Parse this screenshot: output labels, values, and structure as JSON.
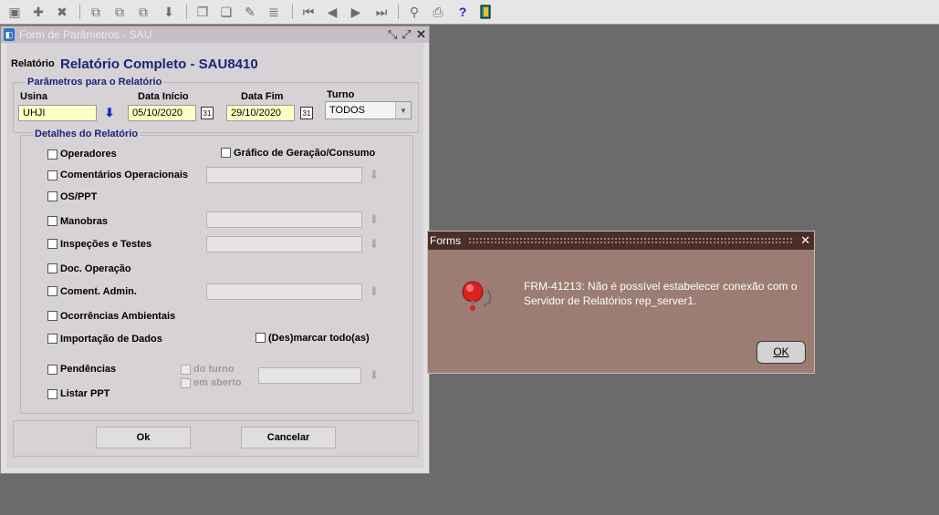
{
  "toolbar": {
    "icons": [
      "save-icon",
      "insert-record-icon",
      "delete-record-icon",
      "enter-query-icon",
      "execute-query-icon",
      "cancel-query-icon",
      "next-block-icon",
      "copy-icon",
      "paste-icon",
      "edit-icon",
      "display-list-icon",
      "first-record-icon",
      "previous-record-icon",
      "next-record-icon",
      "last-record-icon",
      "lock-icon",
      "print-icon",
      "help-icon",
      "exit-icon"
    ],
    "help_glyph": "?"
  },
  "form": {
    "window_title": "Form de Parâmetros - SAU",
    "report_label": "Relatório",
    "report_title": "Relatório Completo - SAU8410",
    "params_legend": "Parâmetros para o Relatório",
    "usina_label": "Usina",
    "usina_value": "UHJI",
    "data_inicio_label": "Data Início",
    "data_inicio_value": "05/10/2020",
    "data_fim_label": "Data Fim",
    "data_fim_value": "29/10/2020",
    "turno_label": "Turno",
    "turno_value": "TODOS",
    "calendar_glyph": "31",
    "details_legend": "Detalhes do Relatório",
    "checkboxes": {
      "operadores": "Operadores",
      "grafico": "Gráfico de Geração/Consumo",
      "comentarios": "Comentários Operacionais",
      "osppt": "OS/PPT",
      "manobras": "Manobras",
      "inspecoes": "Inspeções e Testes",
      "doc_operacao": "Doc. Operação",
      "coment_admin": "Coment. Admin.",
      "ocorrencias": "Ocorrências Ambientais",
      "importacao": "Importação de Dados",
      "desmarcar": "(Des)marcar todo(as)",
      "pendencias": "Pendências",
      "do_turno": "do turno",
      "em_aberto": "em aberto",
      "listar_ppt": "Listar PPT"
    },
    "ok_label": "Ok",
    "cancel_label": "Cancelar"
  },
  "dialog": {
    "title": "Forms",
    "message_line1": "FRM-41213: Não é possível estabelecer conexão com o",
    "message_line2": "Servidor de Relatórios rep_server1.",
    "ok_label": "OK"
  }
}
